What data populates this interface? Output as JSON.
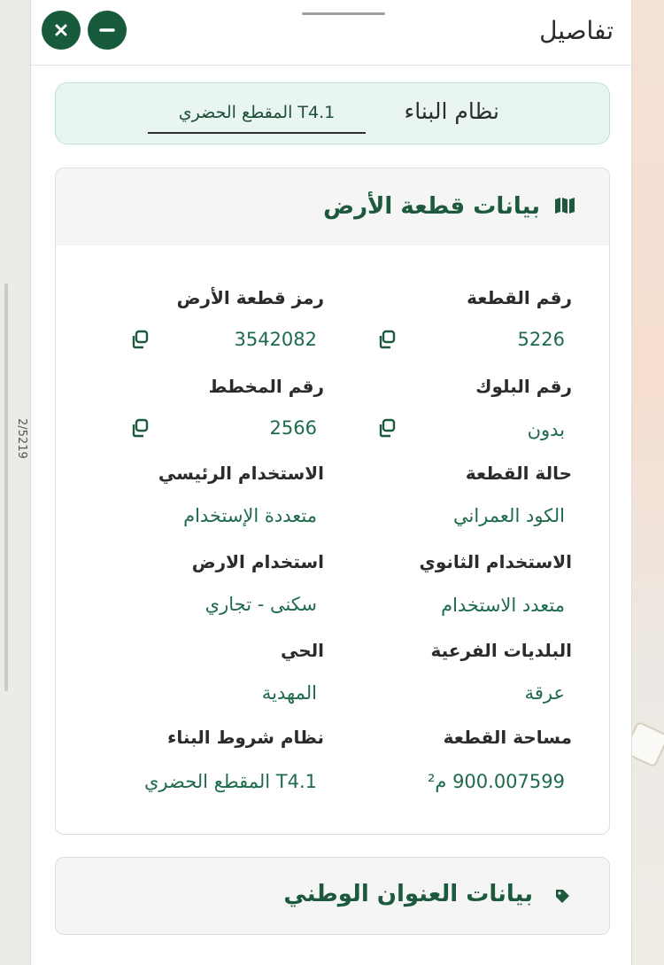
{
  "map": {
    "road_label": "2/5219"
  },
  "header": {
    "title": "تفاصيل",
    "close_icon": "close-icon",
    "minimize_icon": "minus-icon"
  },
  "building_system": {
    "label": "نظام البناء",
    "value": "T4.1 المقطع الحضري"
  },
  "land_card": {
    "title": "بيانات قطعة الأرض",
    "icon": "map-icon",
    "fields": [
      {
        "label": "رقم القطعة",
        "value": "5226"
      },
      {
        "label": "رمز قطعة الأرض",
        "value": "3542082"
      },
      {
        "label": "رقم البلوك",
        "value": "بدون"
      },
      {
        "label": "رقم المخطط",
        "value": "2566"
      },
      {
        "label": "حالة القطعة",
        "value": "الكود العمراني"
      },
      {
        "label": "الاستخدام الرئيسي",
        "value": "متعددة الإستخدام"
      },
      {
        "label": "الاستخدام الثانوي",
        "value": "متعدد الاستخدام"
      },
      {
        "label": "استخدام الارض",
        "value": "سكنى - تجاري"
      },
      {
        "label": "البلديات الفرعية",
        "value": "عرقة"
      },
      {
        "label": "الحي",
        "value": "المهدية"
      },
      {
        "label": "مساحة القطعة",
        "value": "900.007599 م²"
      },
      {
        "label": "نظام شروط البناء",
        "value": "T4.1 المقطع الحضري"
      }
    ]
  },
  "address_card": {
    "title": "بيانات العنوان الوطني",
    "icon": "tag-icon"
  },
  "colors": {
    "brand_green": "#175a3c",
    "value_green": "#1e6b4b",
    "highlight_bg": "#e8f5f0"
  }
}
